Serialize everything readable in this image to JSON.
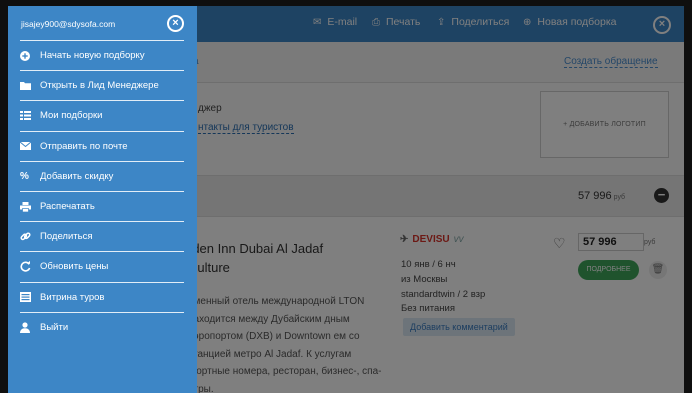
{
  "topbar": {
    "actions": [
      {
        "label": "E-mail",
        "icon": "envelope-icon"
      },
      {
        "label": "Печать",
        "icon": "printer-icon"
      },
      {
        "label": "Поделиться",
        "icon": "share-icon"
      },
      {
        "label": "Новая подборка",
        "icon": "plus-circle-icon"
      }
    ],
    "close_label": "×"
  },
  "subbar": {
    "left_text": "а",
    "right_link": "Создать обращение"
  },
  "info": {
    "line1": "джер",
    "line2": "нтакты для туристов",
    "logo_placeholder": "+ ДОБАВИТЬ ЛОГОТИП"
  },
  "summary": {
    "total_price": "57 996",
    "currency": "руб"
  },
  "hotel": {
    "title": "rden Inn Dubai Al Jadaf Culture",
    "description": "еменный отель международной LTON находится между Дубайским дным аэропортом (DXB) и Downtown ем со станцией метро Al Jadaf. К услугам фортные номера, ресторан, бизнес-, спа- нтры.",
    "operator": "DEVISU",
    "operator_suffix": "vv",
    "dates": "10 янв / 6 нч",
    "from": "из Москвы",
    "room": "standardtwin / 2 взр",
    "meal": "Без питания",
    "comment_button": "Добавить комментарий",
    "price": "57 996",
    "currency": "руб",
    "book_button": "ПОДРОБНЕЕ"
  },
  "drawer": {
    "email": "jisajey900@sdysofa.com",
    "close_label": "×",
    "items": [
      {
        "label": "Начать новую подборку",
        "icon": "plus-circle-icon"
      },
      {
        "label": "Открыть в Лид Менеджере",
        "icon": "folder-icon"
      },
      {
        "label": "Мои подборки",
        "icon": "list-icon"
      },
      {
        "label": "Отправить по почте",
        "icon": "envelope-icon"
      },
      {
        "label": "Добавить скидку",
        "icon": "percent-icon"
      },
      {
        "label": "Распечатать",
        "icon": "printer-icon"
      },
      {
        "label": "Поделиться",
        "icon": "link-icon"
      },
      {
        "label": "Обновить цены",
        "icon": "refresh-icon"
      },
      {
        "label": "Витрина туров",
        "icon": "showcase-icon"
      },
      {
        "label": "Выйти",
        "icon": "user-icon"
      }
    ]
  }
}
